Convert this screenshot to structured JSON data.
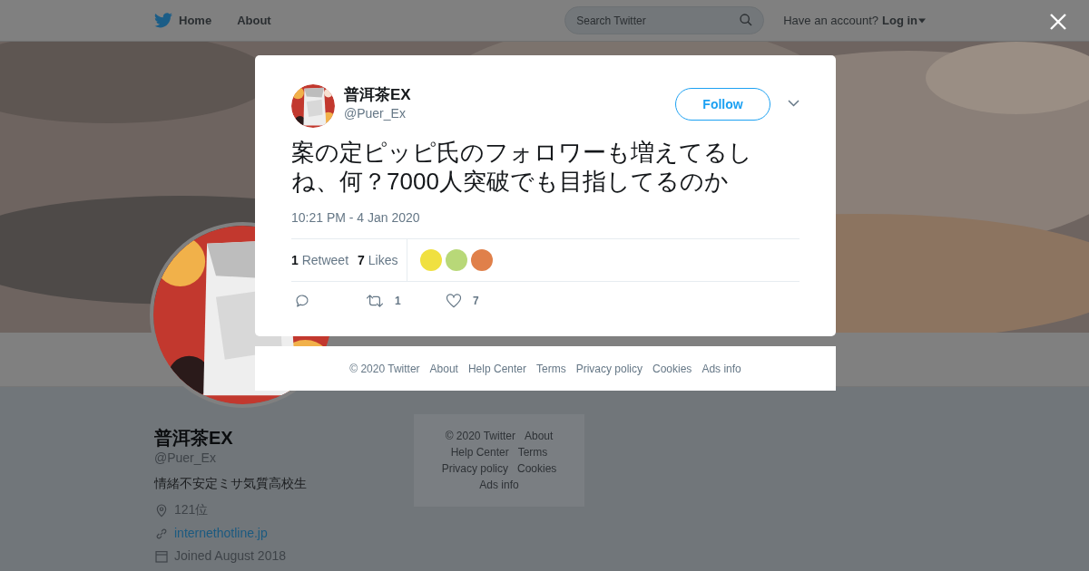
{
  "top_bar": {
    "nav": [
      "Home",
      "About"
    ],
    "search": {
      "placeholder": "Search Twitter"
    },
    "account_prompt": "Have an account?",
    "login": "Log in"
  },
  "profile": {
    "name": "普洱茶EX",
    "handle": "@Puer_Ex",
    "bio": "情緒不安定ミサ気質高校生",
    "location": "121位",
    "website": "internethotline.jp",
    "joined": "Joined August 2018"
  },
  "side_footer": [
    "© 2020 Twitter",
    "About",
    "Help Center",
    "Terms",
    "Privacy policy",
    "Cookies",
    "Ads info"
  ],
  "tweet": {
    "name": "普洱茶EX",
    "handle": "@Puer_Ex",
    "follow": "Follow",
    "text": "案の定ピッピ氏のフォロワーも増えてるしね、何？7000人突破でも目指してるのか",
    "time": "10:21 PM - 4 Jan 2020",
    "stats": [
      {
        "count": "1",
        "label": "Retweet"
      },
      {
        "count": "7",
        "label": "Likes"
      }
    ],
    "likers": [
      {
        "color": "#f0e040"
      },
      {
        "color": "#b8d878"
      },
      {
        "color": "#e0804a"
      }
    ],
    "actions": [
      {
        "kind": "reply"
      },
      {
        "kind": "retweet",
        "count": "1"
      },
      {
        "kind": "like",
        "count": "7"
      }
    ]
  },
  "modal_footer": [
    "© 2020 Twitter",
    "About",
    "Help Center",
    "Terms",
    "Privacy policy",
    "Cookies",
    "Ads info"
  ]
}
